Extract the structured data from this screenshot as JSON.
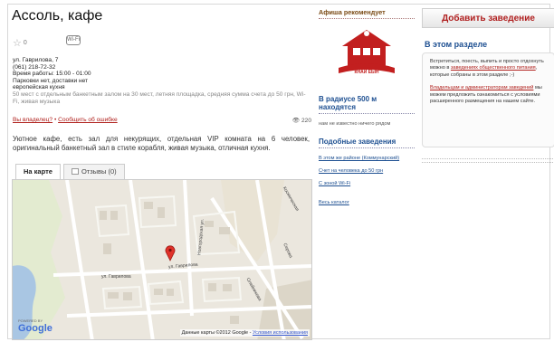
{
  "place": {
    "title": "Ассоль, кафе",
    "rating": "0",
    "wifi_badge": "Wi-Fi",
    "address": "ул. Гаврилова, 7",
    "phone": "(061) 218-72-32",
    "hours": "Время работы: 15:00 - 01:00",
    "parking": "Парковки нет, доставки нет",
    "cuisine": "европейская кухня",
    "details": "50 мест с отдельным банкетным залом на 30 мест, летняя площадка, средняя сумма счета до 50 грн, Wi-Fi, живая музыка",
    "owner_link": "Вы владелец?",
    "bullet": "•",
    "report_link": "Сообщить об ошибке",
    "views": "220",
    "description": "Уютное кафе, есть зал для некурящих, отдельная VIP комната на 6 человек, оригинальный банкетный зал в стиле корабля, живая музыка, отличная кухня."
  },
  "tabs": [
    {
      "label": "На карте"
    },
    {
      "label": "Отзывы (0)"
    }
  ],
  "map": {
    "google_powered": "POWERED BY",
    "google": "Google",
    "attribution": "Данные карты ©2012 Google -",
    "terms_link": "Условия использования",
    "streets": [
      "ул. Гаврилова",
      "Космическая",
      "ул. Гаврилова",
      "Новгородская ул.",
      "Серова",
      "Олейникова"
    ]
  },
  "afisha": {
    "header": "Афиша рекомендует",
    "logo_text": "КНАЙ ЕЫН"
  },
  "nearby": {
    "title": "В радиусе 500 м находятся",
    "empty": "нам не известно ничего рядом"
  },
  "similar": {
    "title": "Подобные заведения",
    "links": [
      "В этом же районе (Коммунарский)",
      "Счет на человека до 50 грн",
      "С зоной Wi-Fi"
    ],
    "catalog": "Весь каталог"
  },
  "sidebar": {
    "add_button": "Добавить заведение",
    "section_title": "В этом разделе",
    "text1": "Встретиться, поесть, выпить и просто отдохнуть можно в",
    "link1": "заведениях общественного питания",
    "text1b": ", которые собраны в этом разделе ;-)",
    "link2": "Владельцам и администраторам заведений",
    "text2": " мы можем предложить ознакомиться с условиями расширенного размещения на нашем сайте."
  }
}
